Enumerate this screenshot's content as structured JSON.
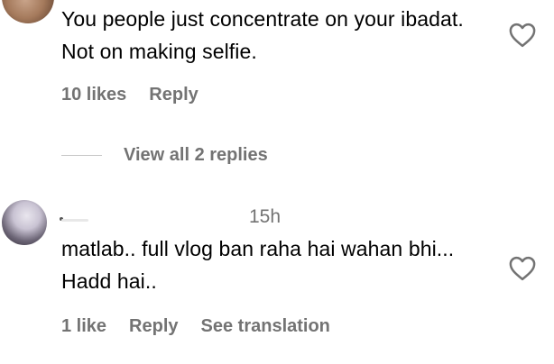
{
  "comments": [
    {
      "text": "You people just concentrate on your ibadat. Not on making selfie.",
      "likes": "10 likes",
      "reply": "Reply",
      "view_replies": "View all 2 replies",
      "avatar_icon": "user-avatar",
      "like_icon": "heart-outline-icon"
    },
    {
      "timestamp": "15h",
      "text": "matlab.. full vlog ban raha hai wahan bhi... Hadd hai..",
      "likes": "1 like",
      "reply": "Reply",
      "translate": "See translation",
      "avatar_icon": "user-avatar",
      "like_icon": "heart-outline-icon"
    }
  ],
  "colors": {
    "text": "#000000",
    "secondary": "#737373",
    "divider": "#c7c7c7"
  }
}
